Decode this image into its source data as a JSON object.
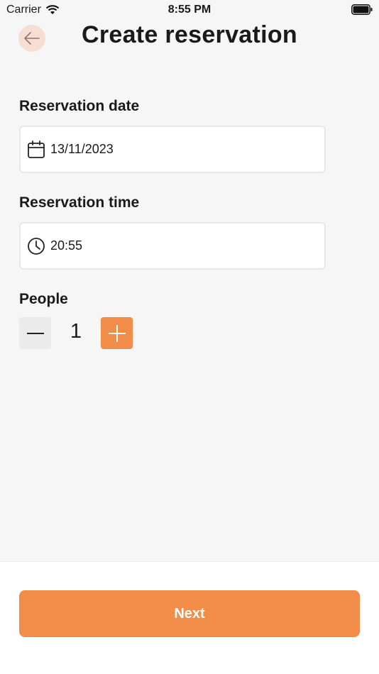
{
  "status_bar": {
    "carrier": "Carrier",
    "time": "8:55 PM"
  },
  "header": {
    "title": "Create reservation",
    "back_icon": "arrow-left-icon"
  },
  "form": {
    "date_label": "Reservation date",
    "date_value": "13/11/2023",
    "date_icon": "calendar-icon",
    "time_label": "Reservation time",
    "time_value": "20:55",
    "time_icon": "clock-icon",
    "people_label": "People",
    "people_count": "1"
  },
  "footer": {
    "next_label": "Next"
  },
  "colors": {
    "accent": "#f28c49",
    "back_button_bg": "#f7ddd3",
    "background": "#f6f6f6"
  }
}
